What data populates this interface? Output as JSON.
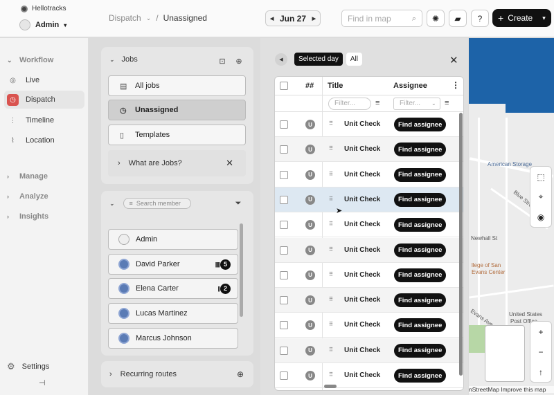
{
  "org": {
    "name": "Hellotracks"
  },
  "user": {
    "name": "Admin"
  },
  "breadcrumb": {
    "section": "Dispatch",
    "page": "Unassigned"
  },
  "date": {
    "label": "Jun 27"
  },
  "map_search": {
    "placeholder": "Find in map"
  },
  "create": {
    "label": "Create"
  },
  "sidebar": {
    "workflow": "Workflow",
    "items": [
      {
        "label": "Live",
        "icon": "live-icon"
      },
      {
        "label": "Dispatch",
        "icon": "dispatch-icon"
      },
      {
        "label": "Timeline",
        "icon": "timeline-icon"
      },
      {
        "label": "Location",
        "icon": "location-icon"
      }
    ],
    "manage": "Manage",
    "analyze": "Analyze",
    "insights": "Insights",
    "settings": "Settings"
  },
  "jobs": {
    "title": "Jobs",
    "all_jobs": "All jobs",
    "unassigned": "Unassigned",
    "templates": "Templates",
    "what_are_jobs": "What are Jobs?"
  },
  "members": {
    "search_placeholder": "Search member",
    "list": [
      {
        "name": "Admin",
        "count": ""
      },
      {
        "name": "David Parker",
        "count": "5"
      },
      {
        "name": "Elena Carter",
        "count": "2"
      },
      {
        "name": "Lucas Martinez",
        "count": ""
      },
      {
        "name": "Marcus Johnson",
        "count": ""
      }
    ]
  },
  "recurring": {
    "label": "Recurring routes"
  },
  "table": {
    "tabs": {
      "selected_day": "Selected day",
      "all": "All"
    },
    "headers": {
      "hash": "##",
      "title": "Title",
      "assignee": "Assignee"
    },
    "filter_placeholder": "Filter...",
    "rows": [
      {
        "avatar": "U",
        "title": "Unit Check",
        "action": "Find assignee"
      },
      {
        "avatar": "U",
        "title": "Unit Check",
        "action": "Find assignee"
      },
      {
        "avatar": "U",
        "title": "Unit Check",
        "action": "Find assignee"
      },
      {
        "avatar": "U",
        "title": "Unit Check",
        "action": "Find assignee"
      },
      {
        "avatar": "U",
        "title": "Unit Check",
        "action": "Find assignee"
      },
      {
        "avatar": "U",
        "title": "Unit Check",
        "action": "Find assignee"
      },
      {
        "avatar": "U",
        "title": "Unit Check",
        "action": "Find assignee"
      },
      {
        "avatar": "U",
        "title": "Unit Check",
        "action": "Find assignee"
      },
      {
        "avatar": "U",
        "title": "Unit Check",
        "action": "Find assignee"
      },
      {
        "avatar": "U",
        "title": "Unit Check",
        "action": "Find assignee"
      },
      {
        "avatar": "U",
        "title": "Unit Check",
        "action": "Find assignee"
      }
    ]
  },
  "map": {
    "labels": [
      "American Storage",
      "Blue Street",
      "Newhall St",
      "llege of San",
      "Evans Center",
      "United States",
      "Post Office",
      "Evans Ave"
    ],
    "attribution": "nStreetMap  Improve this map"
  }
}
